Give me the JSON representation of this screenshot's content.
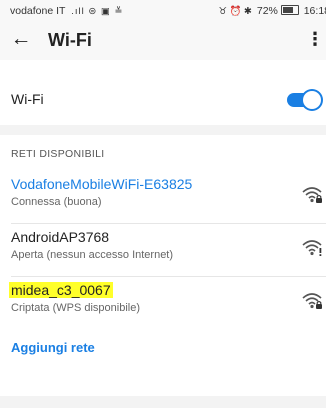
{
  "status_bar": {
    "carrier": "vodafone IT",
    "carrier_icons": ".ıll ⊜ ▣ ≚",
    "right_icons": "♉ ⏰ ✱",
    "battery_text": "72%",
    "time": "16:18"
  },
  "app_bar": {
    "back_icon": "←",
    "title": "Wi-Fi",
    "more_icon": "⋮"
  },
  "wifi_toggle": {
    "label": "Wi-Fi",
    "enabled": true,
    "accent_color": "#1a7fe3"
  },
  "available_networks": {
    "header": "RETI DISPONIBILI",
    "items": [
      {
        "ssid": "VodafoneMobileWiFi-E63825",
        "status": "Connessa (buona)",
        "locked": true,
        "connected": true,
        "signal_icon": "wifi-locked-icon"
      },
      {
        "ssid": "AndroidAP3768",
        "status": "Aperta (nessun accesso Internet)",
        "locked": false,
        "connected": false,
        "signal_icon": "wifi-open-icon"
      },
      {
        "ssid": "midea_c3_0067",
        "status": "Criptata (WPS disponibile)",
        "locked": true,
        "connected": false,
        "highlight": "#ffff2a",
        "signal_icon": "wifi-locked-icon"
      }
    ]
  },
  "add_network": {
    "label": "Aggiungi rete"
  }
}
